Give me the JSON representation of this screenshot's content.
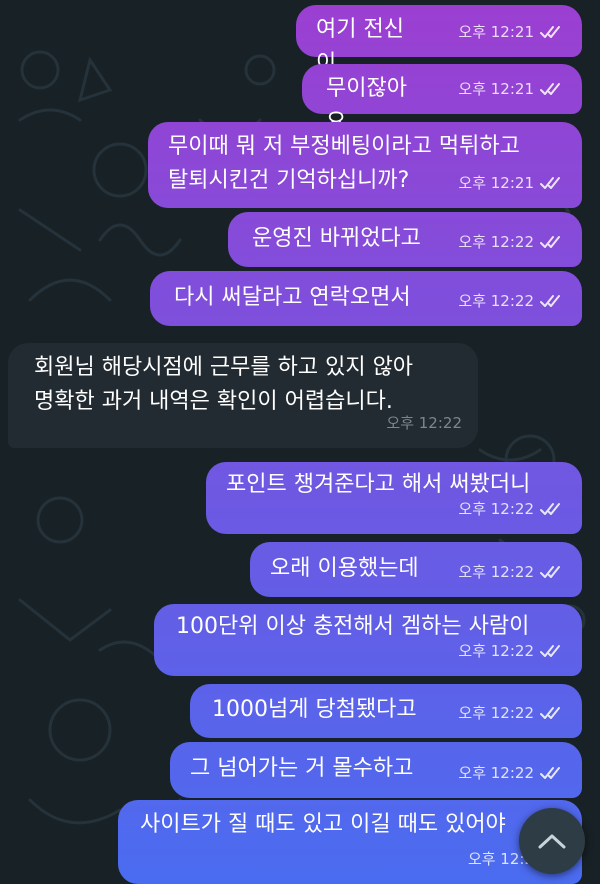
{
  "colors": {
    "background": "#172126",
    "incoming_bubble": "#222b31",
    "outgoing_gradient_top": "#9b3fd1",
    "outgoing_gradient_bottom": "#4a6cf0"
  },
  "messages": [
    {
      "direction": "out",
      "text": "여기 전신이",
      "time": "오후 12:21",
      "status": "read"
    },
    {
      "direction": "out",
      "text": "무이잖아요",
      "time": "오후 12:21",
      "status": "read"
    },
    {
      "direction": "out",
      "text": "무이때 뭐 저 부정베팅이라고 먹튀하고\n탈퇴시킨건 기억하십니까?",
      "time": "오후 12:21",
      "status": "read"
    },
    {
      "direction": "out",
      "text": "운영진 바뀌었다고",
      "time": "오후 12:22",
      "status": "read"
    },
    {
      "direction": "out",
      "text": "다시 써달라고 연락오면서",
      "time": "오후 12:22",
      "status": "read"
    },
    {
      "direction": "in",
      "text": "회원님 해당시점에 근무를 하고 있지 않아\n명확한 과거 내역은 확인이 어렵습니다.",
      "time": "오후 12:22"
    },
    {
      "direction": "out",
      "text": "포인트 챙겨준다고 해서 써봤더니",
      "time": "오후 12:22",
      "status": "read"
    },
    {
      "direction": "out",
      "text": "오래 이용했는데",
      "time": "오후 12:22",
      "status": "read"
    },
    {
      "direction": "out",
      "text": "100단위 이상 충전해서 겜하는 사람이",
      "time": "오후 12:22",
      "status": "read"
    },
    {
      "direction": "out",
      "text": "1000넘게 당첨됐다고",
      "time": "오후 12:22",
      "status": "read"
    },
    {
      "direction": "out",
      "text": "그 넘어가는 거 몰수하고",
      "time": "오후 12:22",
      "status": "read"
    },
    {
      "direction": "out",
      "text": "사이트가 질 때도 있고 이길 때도 있어야",
      "time": "오후 12:2",
      "status": "read"
    }
  ],
  "scroll_button": {
    "icon": "chevron-up-icon"
  }
}
